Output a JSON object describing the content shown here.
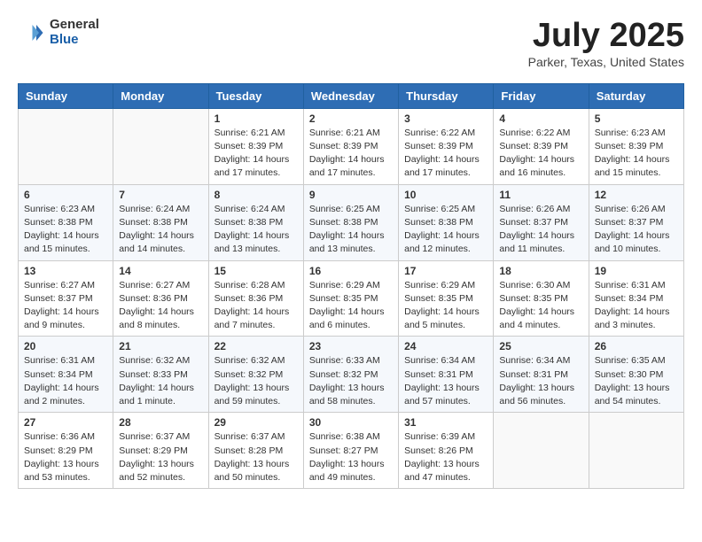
{
  "header": {
    "logo": {
      "general": "General",
      "blue": "Blue"
    },
    "title": "July 2025",
    "location": "Parker, Texas, United States"
  },
  "weekdays": [
    "Sunday",
    "Monday",
    "Tuesday",
    "Wednesday",
    "Thursday",
    "Friday",
    "Saturday"
  ],
  "weeks": [
    [
      {
        "day": "",
        "sunrise": "",
        "sunset": "",
        "daylight": ""
      },
      {
        "day": "",
        "sunrise": "",
        "sunset": "",
        "daylight": ""
      },
      {
        "day": "1",
        "sunrise": "Sunrise: 6:21 AM",
        "sunset": "Sunset: 8:39 PM",
        "daylight": "Daylight: 14 hours and 17 minutes."
      },
      {
        "day": "2",
        "sunrise": "Sunrise: 6:21 AM",
        "sunset": "Sunset: 8:39 PM",
        "daylight": "Daylight: 14 hours and 17 minutes."
      },
      {
        "day": "3",
        "sunrise": "Sunrise: 6:22 AM",
        "sunset": "Sunset: 8:39 PM",
        "daylight": "Daylight: 14 hours and 17 minutes."
      },
      {
        "day": "4",
        "sunrise": "Sunrise: 6:22 AM",
        "sunset": "Sunset: 8:39 PM",
        "daylight": "Daylight: 14 hours and 16 minutes."
      },
      {
        "day": "5",
        "sunrise": "Sunrise: 6:23 AM",
        "sunset": "Sunset: 8:39 PM",
        "daylight": "Daylight: 14 hours and 15 minutes."
      }
    ],
    [
      {
        "day": "6",
        "sunrise": "Sunrise: 6:23 AM",
        "sunset": "Sunset: 8:38 PM",
        "daylight": "Daylight: 14 hours and 15 minutes."
      },
      {
        "day": "7",
        "sunrise": "Sunrise: 6:24 AM",
        "sunset": "Sunset: 8:38 PM",
        "daylight": "Daylight: 14 hours and 14 minutes."
      },
      {
        "day": "8",
        "sunrise": "Sunrise: 6:24 AM",
        "sunset": "Sunset: 8:38 PM",
        "daylight": "Daylight: 14 hours and 13 minutes."
      },
      {
        "day": "9",
        "sunrise": "Sunrise: 6:25 AM",
        "sunset": "Sunset: 8:38 PM",
        "daylight": "Daylight: 14 hours and 13 minutes."
      },
      {
        "day": "10",
        "sunrise": "Sunrise: 6:25 AM",
        "sunset": "Sunset: 8:38 PM",
        "daylight": "Daylight: 14 hours and 12 minutes."
      },
      {
        "day": "11",
        "sunrise": "Sunrise: 6:26 AM",
        "sunset": "Sunset: 8:37 PM",
        "daylight": "Daylight: 14 hours and 11 minutes."
      },
      {
        "day": "12",
        "sunrise": "Sunrise: 6:26 AM",
        "sunset": "Sunset: 8:37 PM",
        "daylight": "Daylight: 14 hours and 10 minutes."
      }
    ],
    [
      {
        "day": "13",
        "sunrise": "Sunrise: 6:27 AM",
        "sunset": "Sunset: 8:37 PM",
        "daylight": "Daylight: 14 hours and 9 minutes."
      },
      {
        "day": "14",
        "sunrise": "Sunrise: 6:27 AM",
        "sunset": "Sunset: 8:36 PM",
        "daylight": "Daylight: 14 hours and 8 minutes."
      },
      {
        "day": "15",
        "sunrise": "Sunrise: 6:28 AM",
        "sunset": "Sunset: 8:36 PM",
        "daylight": "Daylight: 14 hours and 7 minutes."
      },
      {
        "day": "16",
        "sunrise": "Sunrise: 6:29 AM",
        "sunset": "Sunset: 8:35 PM",
        "daylight": "Daylight: 14 hours and 6 minutes."
      },
      {
        "day": "17",
        "sunrise": "Sunrise: 6:29 AM",
        "sunset": "Sunset: 8:35 PM",
        "daylight": "Daylight: 14 hours and 5 minutes."
      },
      {
        "day": "18",
        "sunrise": "Sunrise: 6:30 AM",
        "sunset": "Sunset: 8:35 PM",
        "daylight": "Daylight: 14 hours and 4 minutes."
      },
      {
        "day": "19",
        "sunrise": "Sunrise: 6:31 AM",
        "sunset": "Sunset: 8:34 PM",
        "daylight": "Daylight: 14 hours and 3 minutes."
      }
    ],
    [
      {
        "day": "20",
        "sunrise": "Sunrise: 6:31 AM",
        "sunset": "Sunset: 8:34 PM",
        "daylight": "Daylight: 14 hours and 2 minutes."
      },
      {
        "day": "21",
        "sunrise": "Sunrise: 6:32 AM",
        "sunset": "Sunset: 8:33 PM",
        "daylight": "Daylight: 14 hours and 1 minute."
      },
      {
        "day": "22",
        "sunrise": "Sunrise: 6:32 AM",
        "sunset": "Sunset: 8:32 PM",
        "daylight": "Daylight: 13 hours and 59 minutes."
      },
      {
        "day": "23",
        "sunrise": "Sunrise: 6:33 AM",
        "sunset": "Sunset: 8:32 PM",
        "daylight": "Daylight: 13 hours and 58 minutes."
      },
      {
        "day": "24",
        "sunrise": "Sunrise: 6:34 AM",
        "sunset": "Sunset: 8:31 PM",
        "daylight": "Daylight: 13 hours and 57 minutes."
      },
      {
        "day": "25",
        "sunrise": "Sunrise: 6:34 AM",
        "sunset": "Sunset: 8:31 PM",
        "daylight": "Daylight: 13 hours and 56 minutes."
      },
      {
        "day": "26",
        "sunrise": "Sunrise: 6:35 AM",
        "sunset": "Sunset: 8:30 PM",
        "daylight": "Daylight: 13 hours and 54 minutes."
      }
    ],
    [
      {
        "day": "27",
        "sunrise": "Sunrise: 6:36 AM",
        "sunset": "Sunset: 8:29 PM",
        "daylight": "Daylight: 13 hours and 53 minutes."
      },
      {
        "day": "28",
        "sunrise": "Sunrise: 6:37 AM",
        "sunset": "Sunset: 8:29 PM",
        "daylight": "Daylight: 13 hours and 52 minutes."
      },
      {
        "day": "29",
        "sunrise": "Sunrise: 6:37 AM",
        "sunset": "Sunset: 8:28 PM",
        "daylight": "Daylight: 13 hours and 50 minutes."
      },
      {
        "day": "30",
        "sunrise": "Sunrise: 6:38 AM",
        "sunset": "Sunset: 8:27 PM",
        "daylight": "Daylight: 13 hours and 49 minutes."
      },
      {
        "day": "31",
        "sunrise": "Sunrise: 6:39 AM",
        "sunset": "Sunset: 8:26 PM",
        "daylight": "Daylight: 13 hours and 47 minutes."
      },
      {
        "day": "",
        "sunrise": "",
        "sunset": "",
        "daylight": ""
      },
      {
        "day": "",
        "sunrise": "",
        "sunset": "",
        "daylight": ""
      }
    ]
  ]
}
